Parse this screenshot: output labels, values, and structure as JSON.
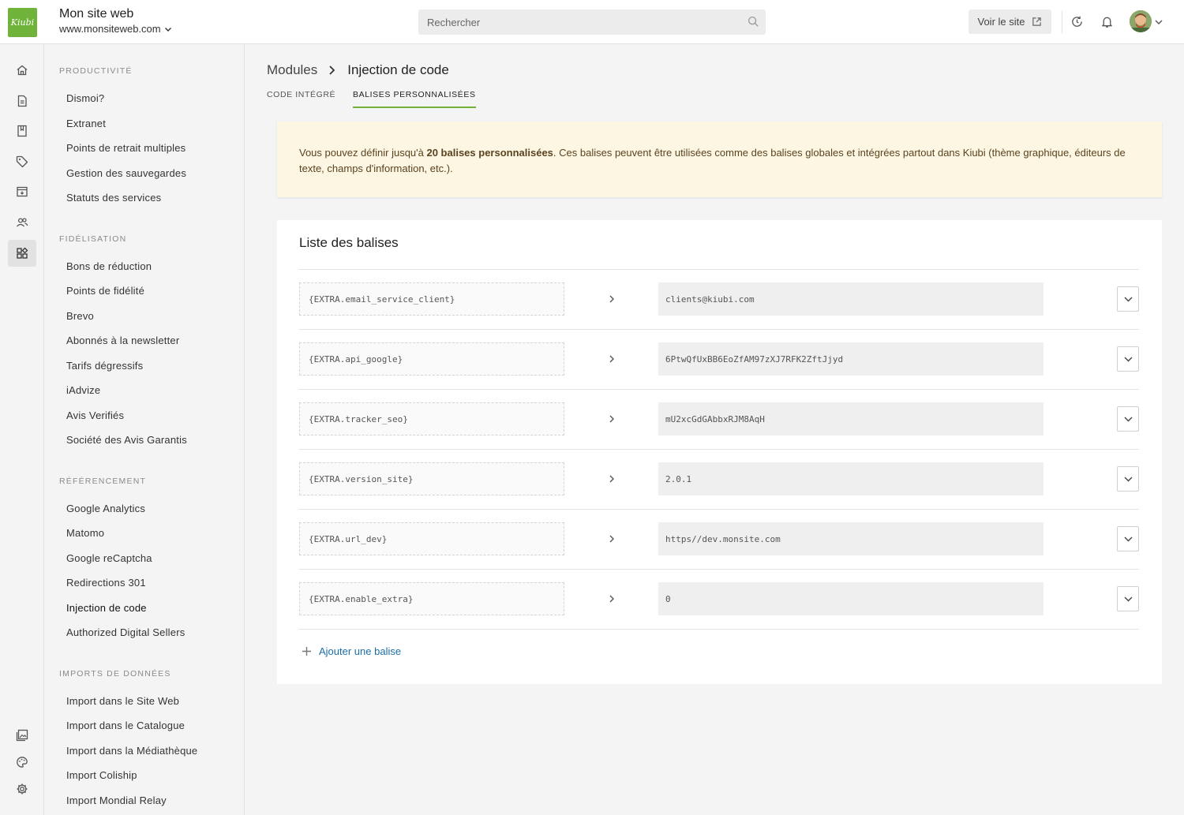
{
  "header": {
    "logo_text": "Kiubi",
    "site_title": "Mon site web",
    "site_url": "www.monsiteweb.com",
    "search_placeholder": "Rechercher",
    "view_site_label": "Voir le site"
  },
  "nav": {
    "sections": [
      {
        "title": "Productivité",
        "items": [
          "Dismoi?",
          "Extranet",
          "Points de retrait multiples",
          "Gestion des sauvegardes",
          "Statuts des services"
        ]
      },
      {
        "title": "Fidélisation",
        "items": [
          "Bons de réduction",
          "Points de fidélité",
          "Brevo",
          "Abonnés à la newsletter",
          "Tarifs dégressifs",
          "iAdvize",
          "Avis Verifiés",
          "Société des Avis Garantis"
        ]
      },
      {
        "title": "Référencement",
        "items": [
          "Google Analytics",
          "Matomo",
          "Google reCaptcha",
          "Redirections 301",
          "Injection de code",
          "Authorized Digital Sellers"
        ]
      },
      {
        "title": "Imports de données",
        "items": [
          "Import dans le Site Web",
          "Import dans le Catalogue",
          "Import dans la Médiathèque",
          "Import Coliship",
          "Import Mondial Relay"
        ]
      }
    ],
    "active_item": "Injection de code"
  },
  "breadcrumb": {
    "parent": "Modules",
    "current": "Injection de code"
  },
  "tabs": [
    {
      "label": "Code intégré",
      "active": false
    },
    {
      "label": "Balises personnalisées",
      "active": true
    }
  ],
  "notice": {
    "before": "Vous pouvez définir jusqu'à ",
    "bold": "20 balises personnalisées",
    "after": ". Ces balises peuvent être utilisées comme des balises globales et intégrées partout dans Kiubi (thème graphique, éditeurs de texte, champs d'information, etc.)."
  },
  "tag_list": {
    "title": "Liste des balises",
    "rows": [
      {
        "key": "{EXTRA.email_service_client}",
        "value": "clients@kiubi.com"
      },
      {
        "key": "{EXTRA.api_google}",
        "value": "6PtwQfUxBB6EoZfAM97zXJ7RFK2ZftJjyd"
      },
      {
        "key": "{EXTRA.tracker_seo}",
        "value": "mU2xcGdGAbbxRJM8AqH"
      },
      {
        "key": "{EXTRA.version_site}",
        "value": "2.0.1"
      },
      {
        "key": "{EXTRA.url_dev}",
        "value": "https//dev.monsite.com"
      },
      {
        "key": "{EXTRA.enable_extra}",
        "value": "0"
      }
    ],
    "add_label": "Ajouter une balise"
  },
  "colors": {
    "accent": "#6fb33a",
    "link": "#1a6ea8",
    "notice_bg": "#fdf6e2"
  }
}
